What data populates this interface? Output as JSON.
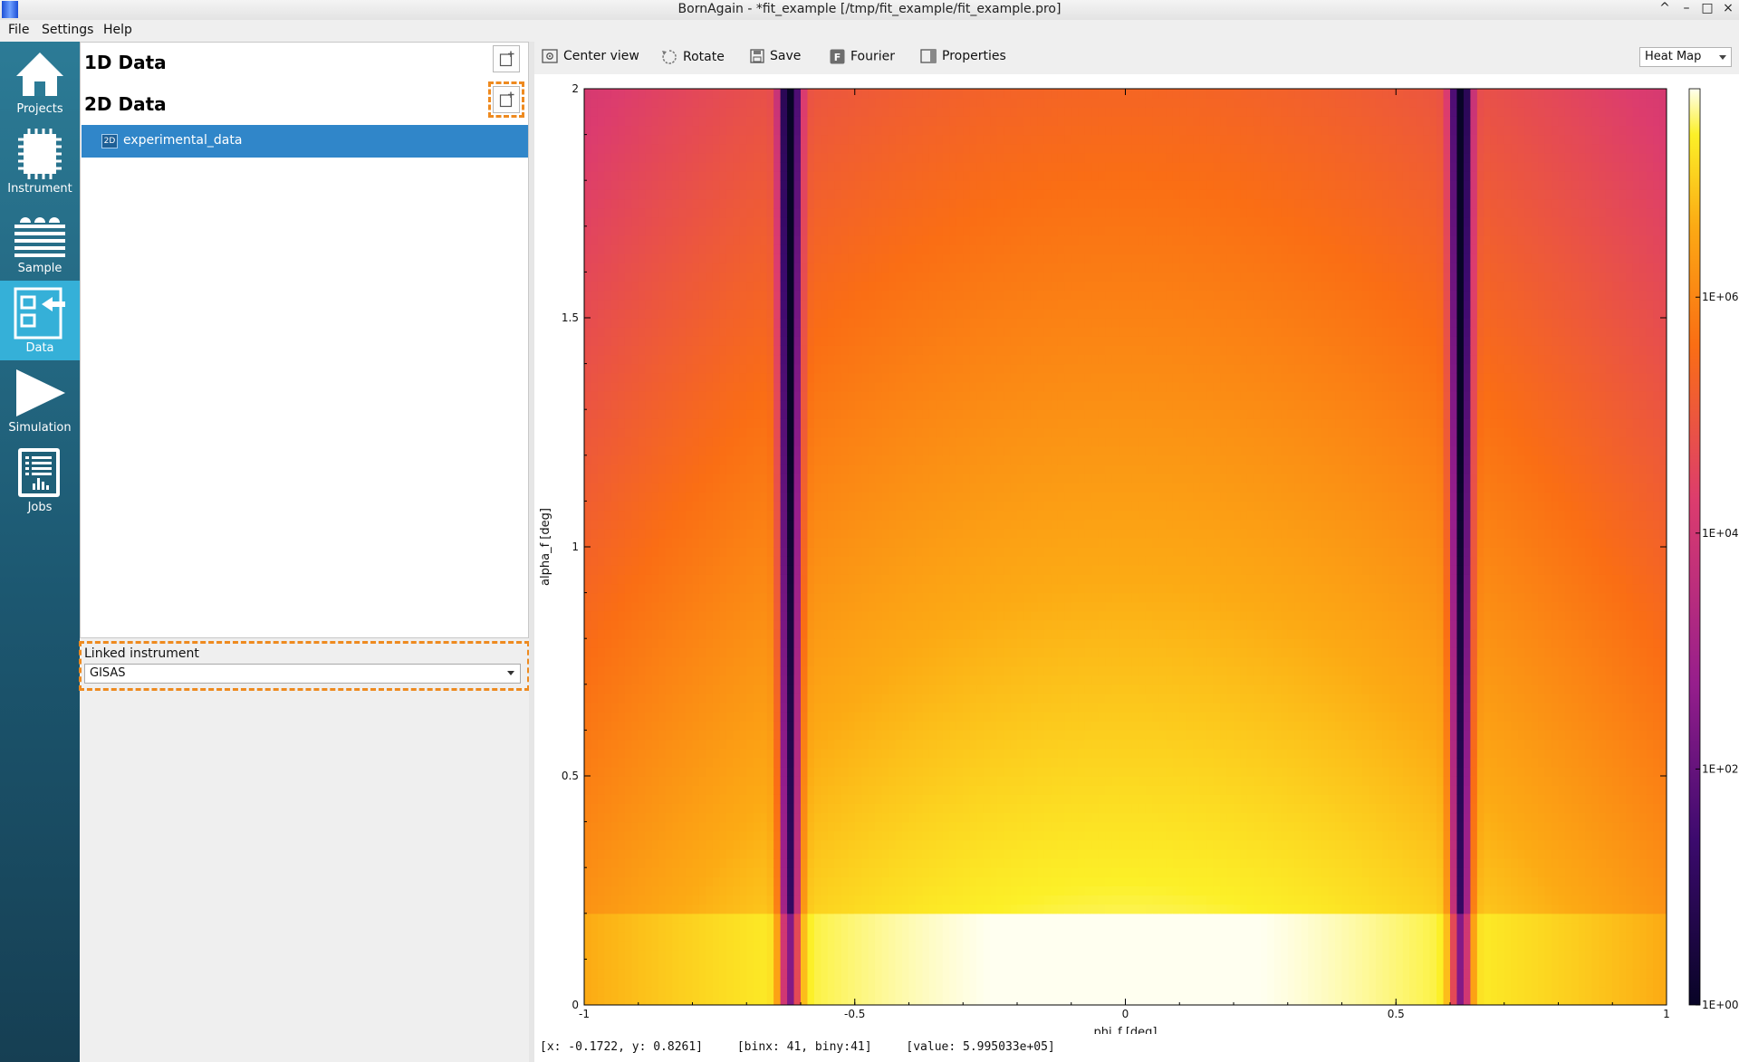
{
  "window": {
    "title": "BornAgain - *fit_example [/tmp/fit_example/fit_example.pro]",
    "controls": [
      "^",
      "–",
      "□",
      "×"
    ]
  },
  "menubar": {
    "items": [
      "File",
      "Settings",
      "Help"
    ]
  },
  "sidebar": {
    "items": [
      {
        "label": "Projects",
        "icon": "home-icon"
      },
      {
        "label": "Instrument",
        "icon": "chip-icon"
      },
      {
        "label": "Sample",
        "icon": "sample-layers-icon"
      },
      {
        "label": "Data",
        "icon": "data-import-icon",
        "active": true
      },
      {
        "label": "Simulation",
        "icon": "play-icon"
      },
      {
        "label": "Jobs",
        "icon": "jobs-report-icon"
      }
    ],
    "active_color": "#35b0d8"
  },
  "data_tree": {
    "section_1d": "1D Data",
    "section_2d": "2D Data",
    "items_2d": [
      {
        "badge": "2D",
        "name": "experimental_data",
        "selected": true
      }
    ],
    "selection_color": "#3086c9",
    "highlight_color": "#ee8a1f"
  },
  "linked_instrument": {
    "label": "Linked instrument",
    "value": "GISAS"
  },
  "toolbar": {
    "center_view": "Center view",
    "rotate": "Rotate",
    "save": "Save",
    "fourier": "Fourier",
    "properties": "Properties",
    "plot_mode": "Heat Map"
  },
  "chart_data": {
    "type": "heatmap",
    "xlabel": "phi_f [deg]",
    "ylabel": "alpha_f [deg]",
    "xlim": [
      -1,
      1
    ],
    "ylim": [
      0,
      2
    ],
    "x_ticks": [
      "-1",
      "-0.5",
      "0",
      "0.5",
      "1"
    ],
    "y_ticks": [
      "0",
      "0.5",
      "1",
      "1.5",
      "2"
    ],
    "colorbar_ticks": [
      "1E+00",
      "1E+02",
      "1E+04",
      "1E+06"
    ],
    "colorbar_scale": "log",
    "colormap": "inferno-like (black → purple → red → orange → yellow → white)",
    "grid": false,
    "features": {
      "dark_vertical_bands_phi": [
        -0.62,
        0.62
      ],
      "intensity_peak": {
        "phi": 0.0,
        "alpha": 0.12
      },
      "horizon_alpha": 0.2
    }
  },
  "status_bar": {
    "coords": "[x: -0.1722, y: 0.8261]",
    "bins": "[binx: 41, biny:41]",
    "value": "[value: 5.995033e+05]"
  }
}
